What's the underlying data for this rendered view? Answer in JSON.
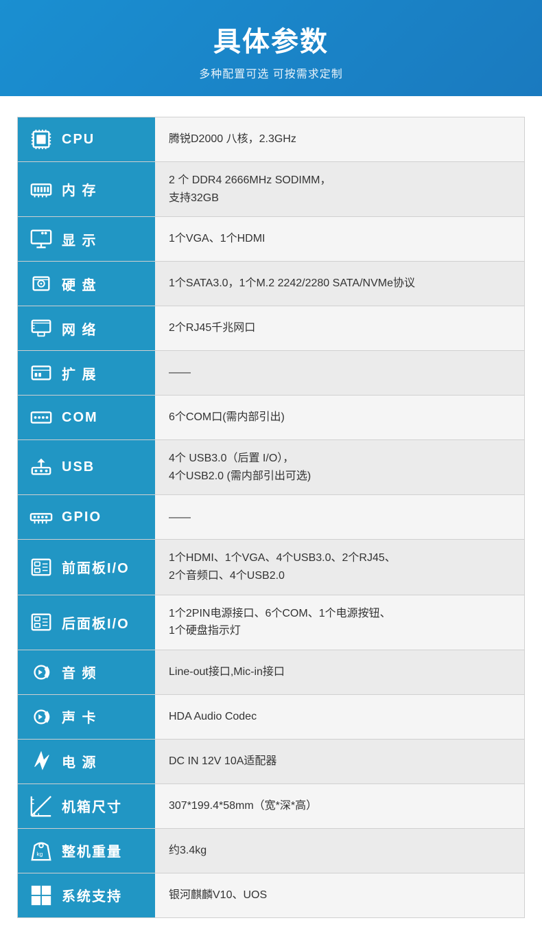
{
  "header": {
    "title": "具体参数",
    "subtitle": "多种配置可选 可按需求定制"
  },
  "specs": [
    {
      "id": "cpu",
      "icon": "cpu",
      "label": "CPU",
      "value": "腾锐D2000 八核，2.3GHz",
      "multiline": false
    },
    {
      "id": "memory",
      "icon": "memory",
      "label": "内  存",
      "value": "2 个 DDR4 2666MHz SODIMM，\n支持32GB",
      "multiline": true
    },
    {
      "id": "display",
      "icon": "display",
      "label": "显  示",
      "value": "1个VGA、1个HDMI",
      "multiline": false
    },
    {
      "id": "storage",
      "icon": "storage",
      "label": "硬  盘",
      "value": "1个SATA3.0，1个M.2 2242/2280 SATA/NVMe协议",
      "multiline": false
    },
    {
      "id": "network",
      "icon": "network",
      "label": "网  络",
      "value": "2个RJ45千兆网口",
      "multiline": false
    },
    {
      "id": "expand",
      "icon": "expand",
      "label": "扩  展",
      "value": "——",
      "multiline": false
    },
    {
      "id": "com",
      "icon": "com",
      "label": "COM",
      "value": "6个COM口(需内部引出)",
      "multiline": false
    },
    {
      "id": "usb",
      "icon": "usb",
      "label": "USB",
      "value": "4个 USB3.0（后置 I/O），\n4个USB2.0 (需内部引出可选)",
      "multiline": true
    },
    {
      "id": "gpio",
      "icon": "gpio",
      "label": "GPIO",
      "value": "——",
      "multiline": false
    },
    {
      "id": "front-panel",
      "icon": "front-panel",
      "label": "前面板I/O",
      "value": "1个HDMI、1个VGA、4个USB3.0、2个RJ45、\n2个音频口、4个USB2.0",
      "multiline": true
    },
    {
      "id": "rear-panel",
      "icon": "rear-panel",
      "label": "后面板I/O",
      "value": "1个2PIN电源接口、6个COM、1个电源按钮、\n1个硬盘指示灯",
      "multiline": true
    },
    {
      "id": "audio-port",
      "icon": "audio",
      "label": "音  频",
      "value": "Line-out接口,Mic-in接口",
      "multiline": false
    },
    {
      "id": "sound-card",
      "icon": "sound",
      "label": "声  卡",
      "value": "HDA Audio Codec",
      "multiline": false
    },
    {
      "id": "power",
      "icon": "power",
      "label": "电  源",
      "value": "DC IN 12V 10A适配器",
      "multiline": false
    },
    {
      "id": "dimensions",
      "icon": "dimensions",
      "label": "机箱尺寸",
      "value": "307*199.4*58mm（宽*深*高）",
      "multiline": false
    },
    {
      "id": "weight",
      "icon": "weight",
      "label": "整机重量",
      "value": "约3.4kg",
      "multiline": false
    },
    {
      "id": "os",
      "icon": "os",
      "label": "系统支持",
      "value": "银河麒麟V10、UOS",
      "multiline": false
    }
  ],
  "icons": {
    "cpu": "🖥",
    "memory": "💾",
    "display": "🖵",
    "storage": "💿",
    "network": "🌐",
    "expand": "📡",
    "com": "🔌",
    "usb": "⬆",
    "gpio": "🔗",
    "front-panel": "📋",
    "rear-panel": "📋",
    "audio": "🔊",
    "sound": "🔊",
    "power": "⚡",
    "dimensions": "📐",
    "weight": "⚖",
    "os": "🪟"
  }
}
